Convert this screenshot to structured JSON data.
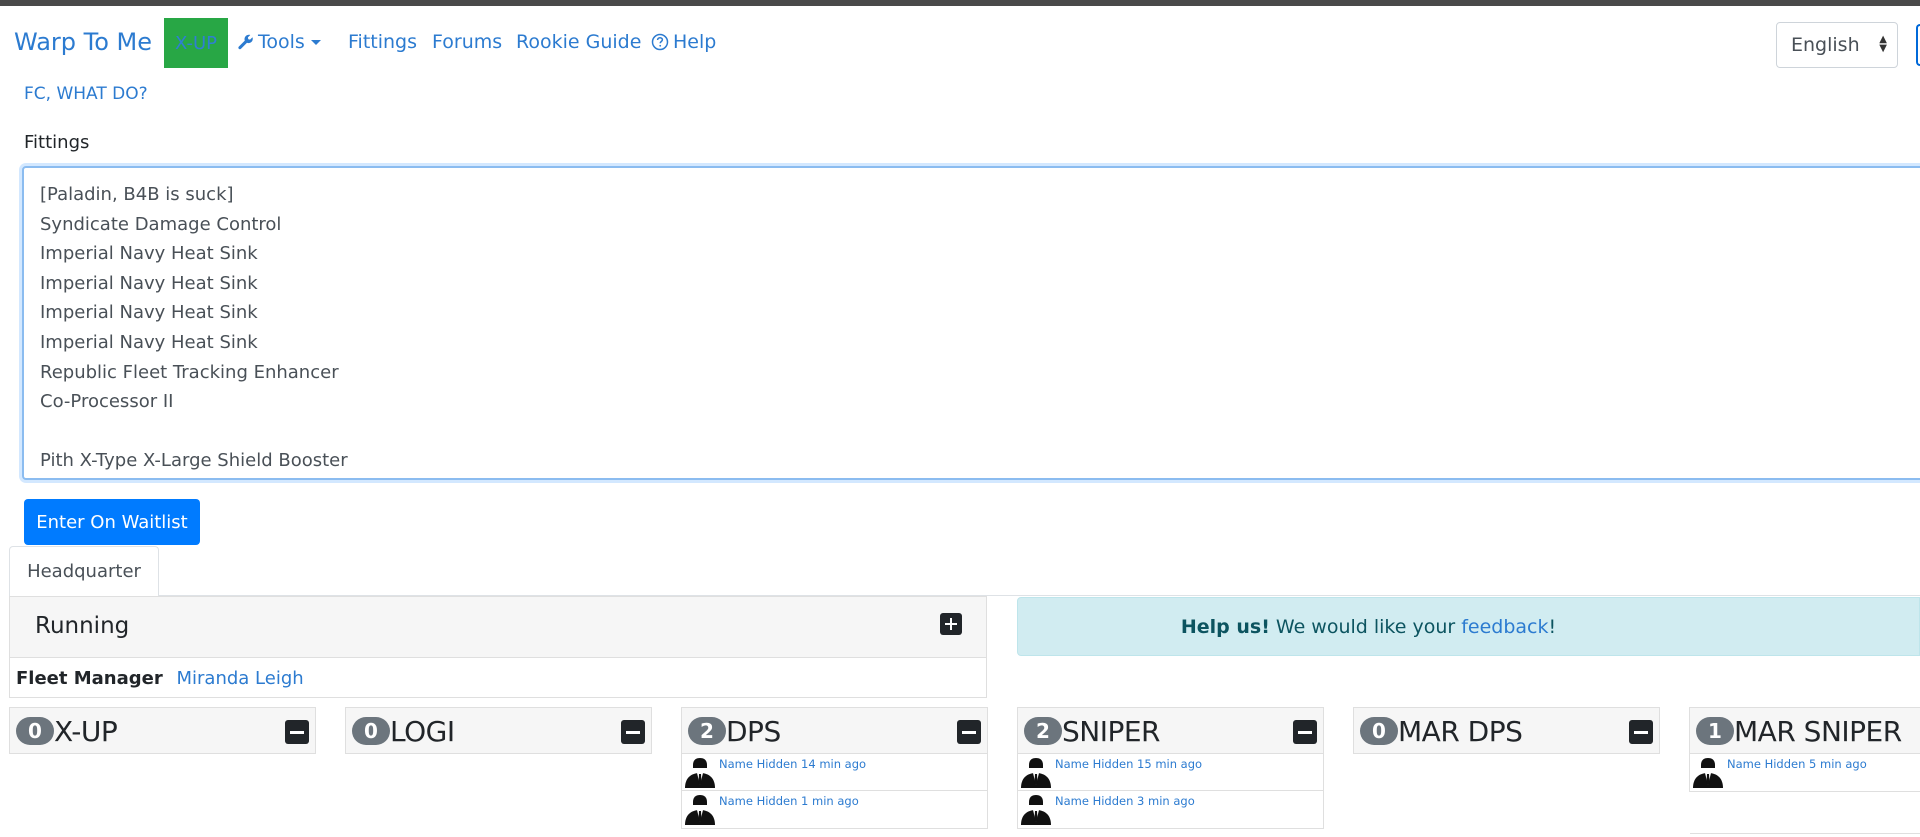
{
  "nav": {
    "brand": "Warp To Me",
    "xup_button": "X-UP",
    "tools": "Tools",
    "fittings": "Fittings",
    "forums": "Forums",
    "rookie_guide": "Rookie Guide",
    "help": "Help",
    "language": "English"
  },
  "fc_link": "FC, WHAT DO?",
  "fittings_form": {
    "label": "Fittings",
    "lines": [
      "[Paladin, B4B is suck]",
      "Syndicate Damage Control",
      "Imperial Navy Heat Sink",
      "Imperial Navy Heat Sink",
      "Imperial Navy Heat Sink",
      "Imperial Navy Heat Sink",
      "Republic Fleet Tracking Enhancer",
      "Co-Processor II",
      "",
      "Pith X-Type X-Large Shield Booster"
    ],
    "submit": "Enter On Waitlist"
  },
  "tabs": [
    "Headquarter"
  ],
  "fleet": {
    "status": "Running",
    "manager_label": "Fleet Manager",
    "manager_name": "Miranda Leigh"
  },
  "help_alert": {
    "bold": "Help us!",
    "text": "We would like your",
    "link": "feedback",
    "end": "!"
  },
  "categories": [
    {
      "count": "0",
      "name": "X-UP",
      "entries": []
    },
    {
      "count": "0",
      "name": "LOGI",
      "entries": []
    },
    {
      "count": "2",
      "name": "DPS",
      "entries": [
        "Name Hidden 14 min ago",
        "Name Hidden 1 min ago"
      ]
    },
    {
      "count": "2",
      "name": "SNIPER",
      "entries": [
        "Name Hidden 15 min ago",
        "Name Hidden 3 min ago"
      ]
    },
    {
      "count": "0",
      "name": "MAR DPS",
      "entries": []
    },
    {
      "count": "1",
      "name": "MAR SNIPER",
      "entries": [
        "Name Hidden 5 min ago"
      ]
    }
  ],
  "colors": {
    "link": "#2c7bd0",
    "xup_green": "#28a745",
    "primary": "#007bff",
    "alert_bg": "#d1ecf1",
    "badge": "#6c757d"
  },
  "icons": {
    "tools": "wrench-icon",
    "help": "question-circle-icon",
    "add": "plus-square-icon",
    "collapse": "minus-square-icon",
    "avatar": "anonymous-suit-avatar-icon"
  }
}
